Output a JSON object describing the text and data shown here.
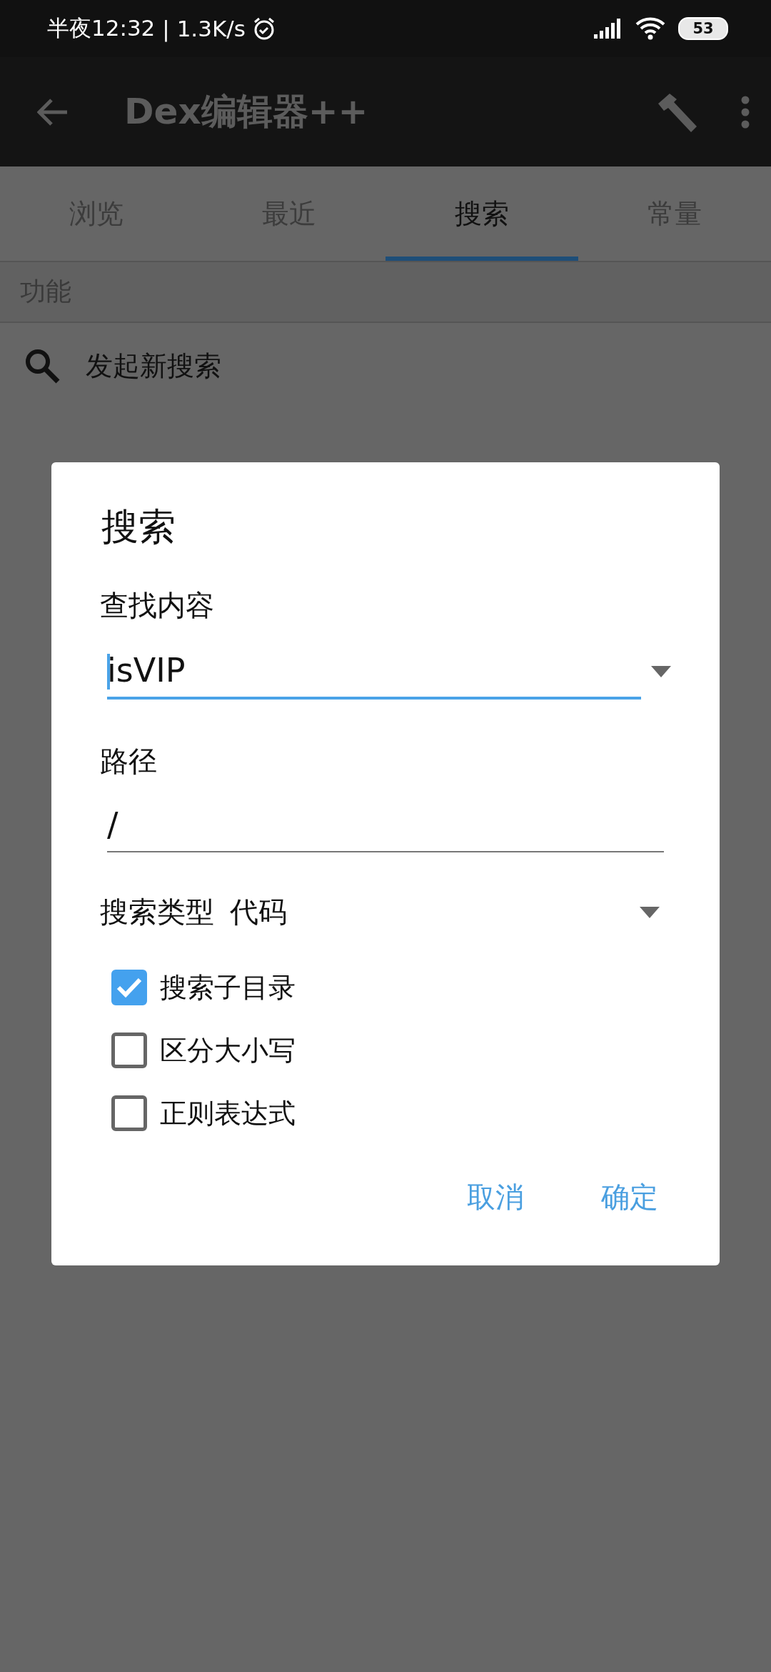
{
  "status_bar": {
    "time": "半夜12:32",
    "speed": "| 1.3K/s",
    "battery": "53"
  },
  "app_bar": {
    "title": "Dex编辑器++"
  },
  "tabs": [
    {
      "label": "浏览",
      "selected": false
    },
    {
      "label": "最近",
      "selected": false
    },
    {
      "label": "搜索",
      "selected": true
    },
    {
      "label": "常量",
      "selected": false
    }
  ],
  "section": {
    "header": "功能",
    "items": [
      {
        "label": "发起新搜索"
      }
    ]
  },
  "dialog": {
    "title": "搜索",
    "find": {
      "label": "查找内容",
      "value": "isVIP"
    },
    "path": {
      "label": "路径",
      "value": "/"
    },
    "search_type": {
      "label": "搜索类型",
      "value": "代码"
    },
    "options": [
      {
        "label": "搜索子目录",
        "checked": true
      },
      {
        "label": "区分大小写",
        "checked": false
      },
      {
        "label": "正则表达式",
        "checked": false
      }
    ],
    "buttons": [
      "取消",
      "确定"
    ]
  }
}
